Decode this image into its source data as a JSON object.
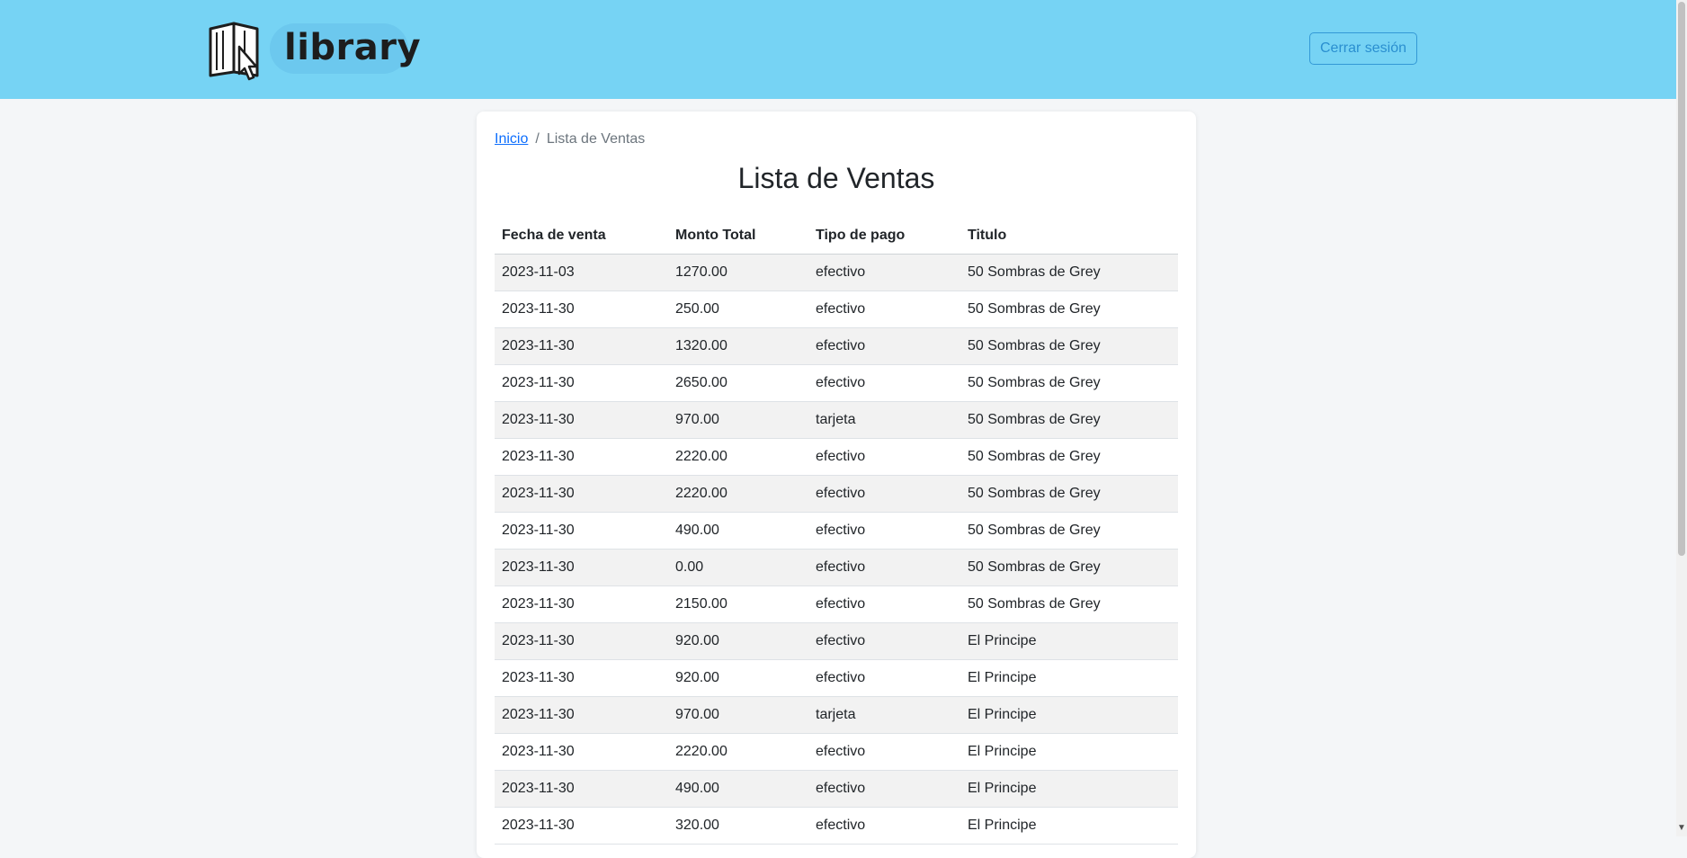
{
  "header": {
    "logo_text": "library",
    "logout_label": "Cerrar sesión"
  },
  "breadcrumb": {
    "home": "Inicio",
    "separator": "/",
    "current": "Lista de Ventas"
  },
  "page_title": "Lista de Ventas",
  "table": {
    "columns": [
      "Fecha de venta",
      "Monto Total",
      "Tipo de pago",
      "Titulo"
    ],
    "rows": [
      [
        "2023-11-03",
        "1270.00",
        "efectivo",
        "50 Sombras de Grey"
      ],
      [
        "2023-11-30",
        "250.00",
        "efectivo",
        "50 Sombras de Grey"
      ],
      [
        "2023-11-30",
        "1320.00",
        "efectivo",
        "50 Sombras de Grey"
      ],
      [
        "2023-11-30",
        "2650.00",
        "efectivo",
        "50 Sombras de Grey"
      ],
      [
        "2023-11-30",
        "970.00",
        "tarjeta",
        "50 Sombras de Grey"
      ],
      [
        "2023-11-30",
        "2220.00",
        "efectivo",
        "50 Sombras de Grey"
      ],
      [
        "2023-11-30",
        "2220.00",
        "efectivo",
        "50 Sombras de Grey"
      ],
      [
        "2023-11-30",
        "490.00",
        "efectivo",
        "50 Sombras de Grey"
      ],
      [
        "2023-11-30",
        "0.00",
        "efectivo",
        "50 Sombras de Grey"
      ],
      [
        "2023-11-30",
        "2150.00",
        "efectivo",
        "50 Sombras de Grey"
      ],
      [
        "2023-11-30",
        "920.00",
        "efectivo",
        "El Principe"
      ],
      [
        "2023-11-30",
        "920.00",
        "efectivo",
        "El Principe"
      ],
      [
        "2023-11-30",
        "970.00",
        "tarjeta",
        "El Principe"
      ],
      [
        "2023-11-30",
        "2220.00",
        "efectivo",
        "El Principe"
      ],
      [
        "2023-11-30",
        "490.00",
        "efectivo",
        "El Principe"
      ],
      [
        "2023-11-30",
        "320.00",
        "efectivo",
        "El Principe"
      ]
    ]
  },
  "colors": {
    "header_bg": "#76d3f4",
    "accent": "#2a8fd0",
    "link": "#0d6efd",
    "stripe": "#f2f2f2"
  },
  "icons": {
    "logo": "open-book-cursor-icon",
    "scroll": "chevron-down-icon"
  }
}
